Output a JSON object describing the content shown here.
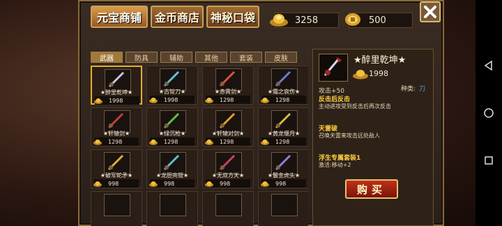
{
  "top_tabs": [
    "元宝商铺",
    "金币商店",
    "神秘口袋"
  ],
  "currency": {
    "yuanbao": "3258",
    "gold": "500"
  },
  "category_tabs": [
    "武器",
    "防具",
    "辅助",
    "其他",
    "套装",
    "皮肤"
  ],
  "items": [
    {
      "name": "★醉里乾坤★",
      "price": "1998"
    },
    {
      "name": "★古锭刀★",
      "price": "1998"
    },
    {
      "name": "★赤霄剑★",
      "price": "1298"
    },
    {
      "name": "★霜之哀伤★",
      "price": "1298"
    },
    {
      "name": "★轩辕剑★",
      "price": "1298"
    },
    {
      "name": "★绿沉枪★",
      "price": "1298"
    },
    {
      "name": "★轩辕对剑★",
      "price": "1298"
    },
    {
      "name": "★黄龙偃月★",
      "price": "1298"
    },
    {
      "name": "★破军蛇矛★",
      "price": "998"
    },
    {
      "name": "★龙胆亮银★",
      "price": "998"
    },
    {
      "name": "★无双方天★",
      "price": "998"
    },
    {
      "name": "★鬟金虎头★",
      "price": "998"
    }
  ],
  "detail": {
    "name": "★醉里乾坤★",
    "price": "1998",
    "attack": "攻击+50",
    "type_label": "种类:",
    "type_value": "刀",
    "skill1_title": "反击后反击",
    "skill1_desc": "主动进攻受到反击后再次反击",
    "skill2_title": "天雷破",
    "skill2_desc": "召唤天雷来攻击远处敌人",
    "set_title": "浮生专属套装1",
    "set_desc": "激活:移动+2",
    "buy_label": "购买"
  },
  "colors": {
    "accent_gold": "#ffd040",
    "buy_red": "#c03018",
    "type_blue": "#4aa0ff"
  }
}
